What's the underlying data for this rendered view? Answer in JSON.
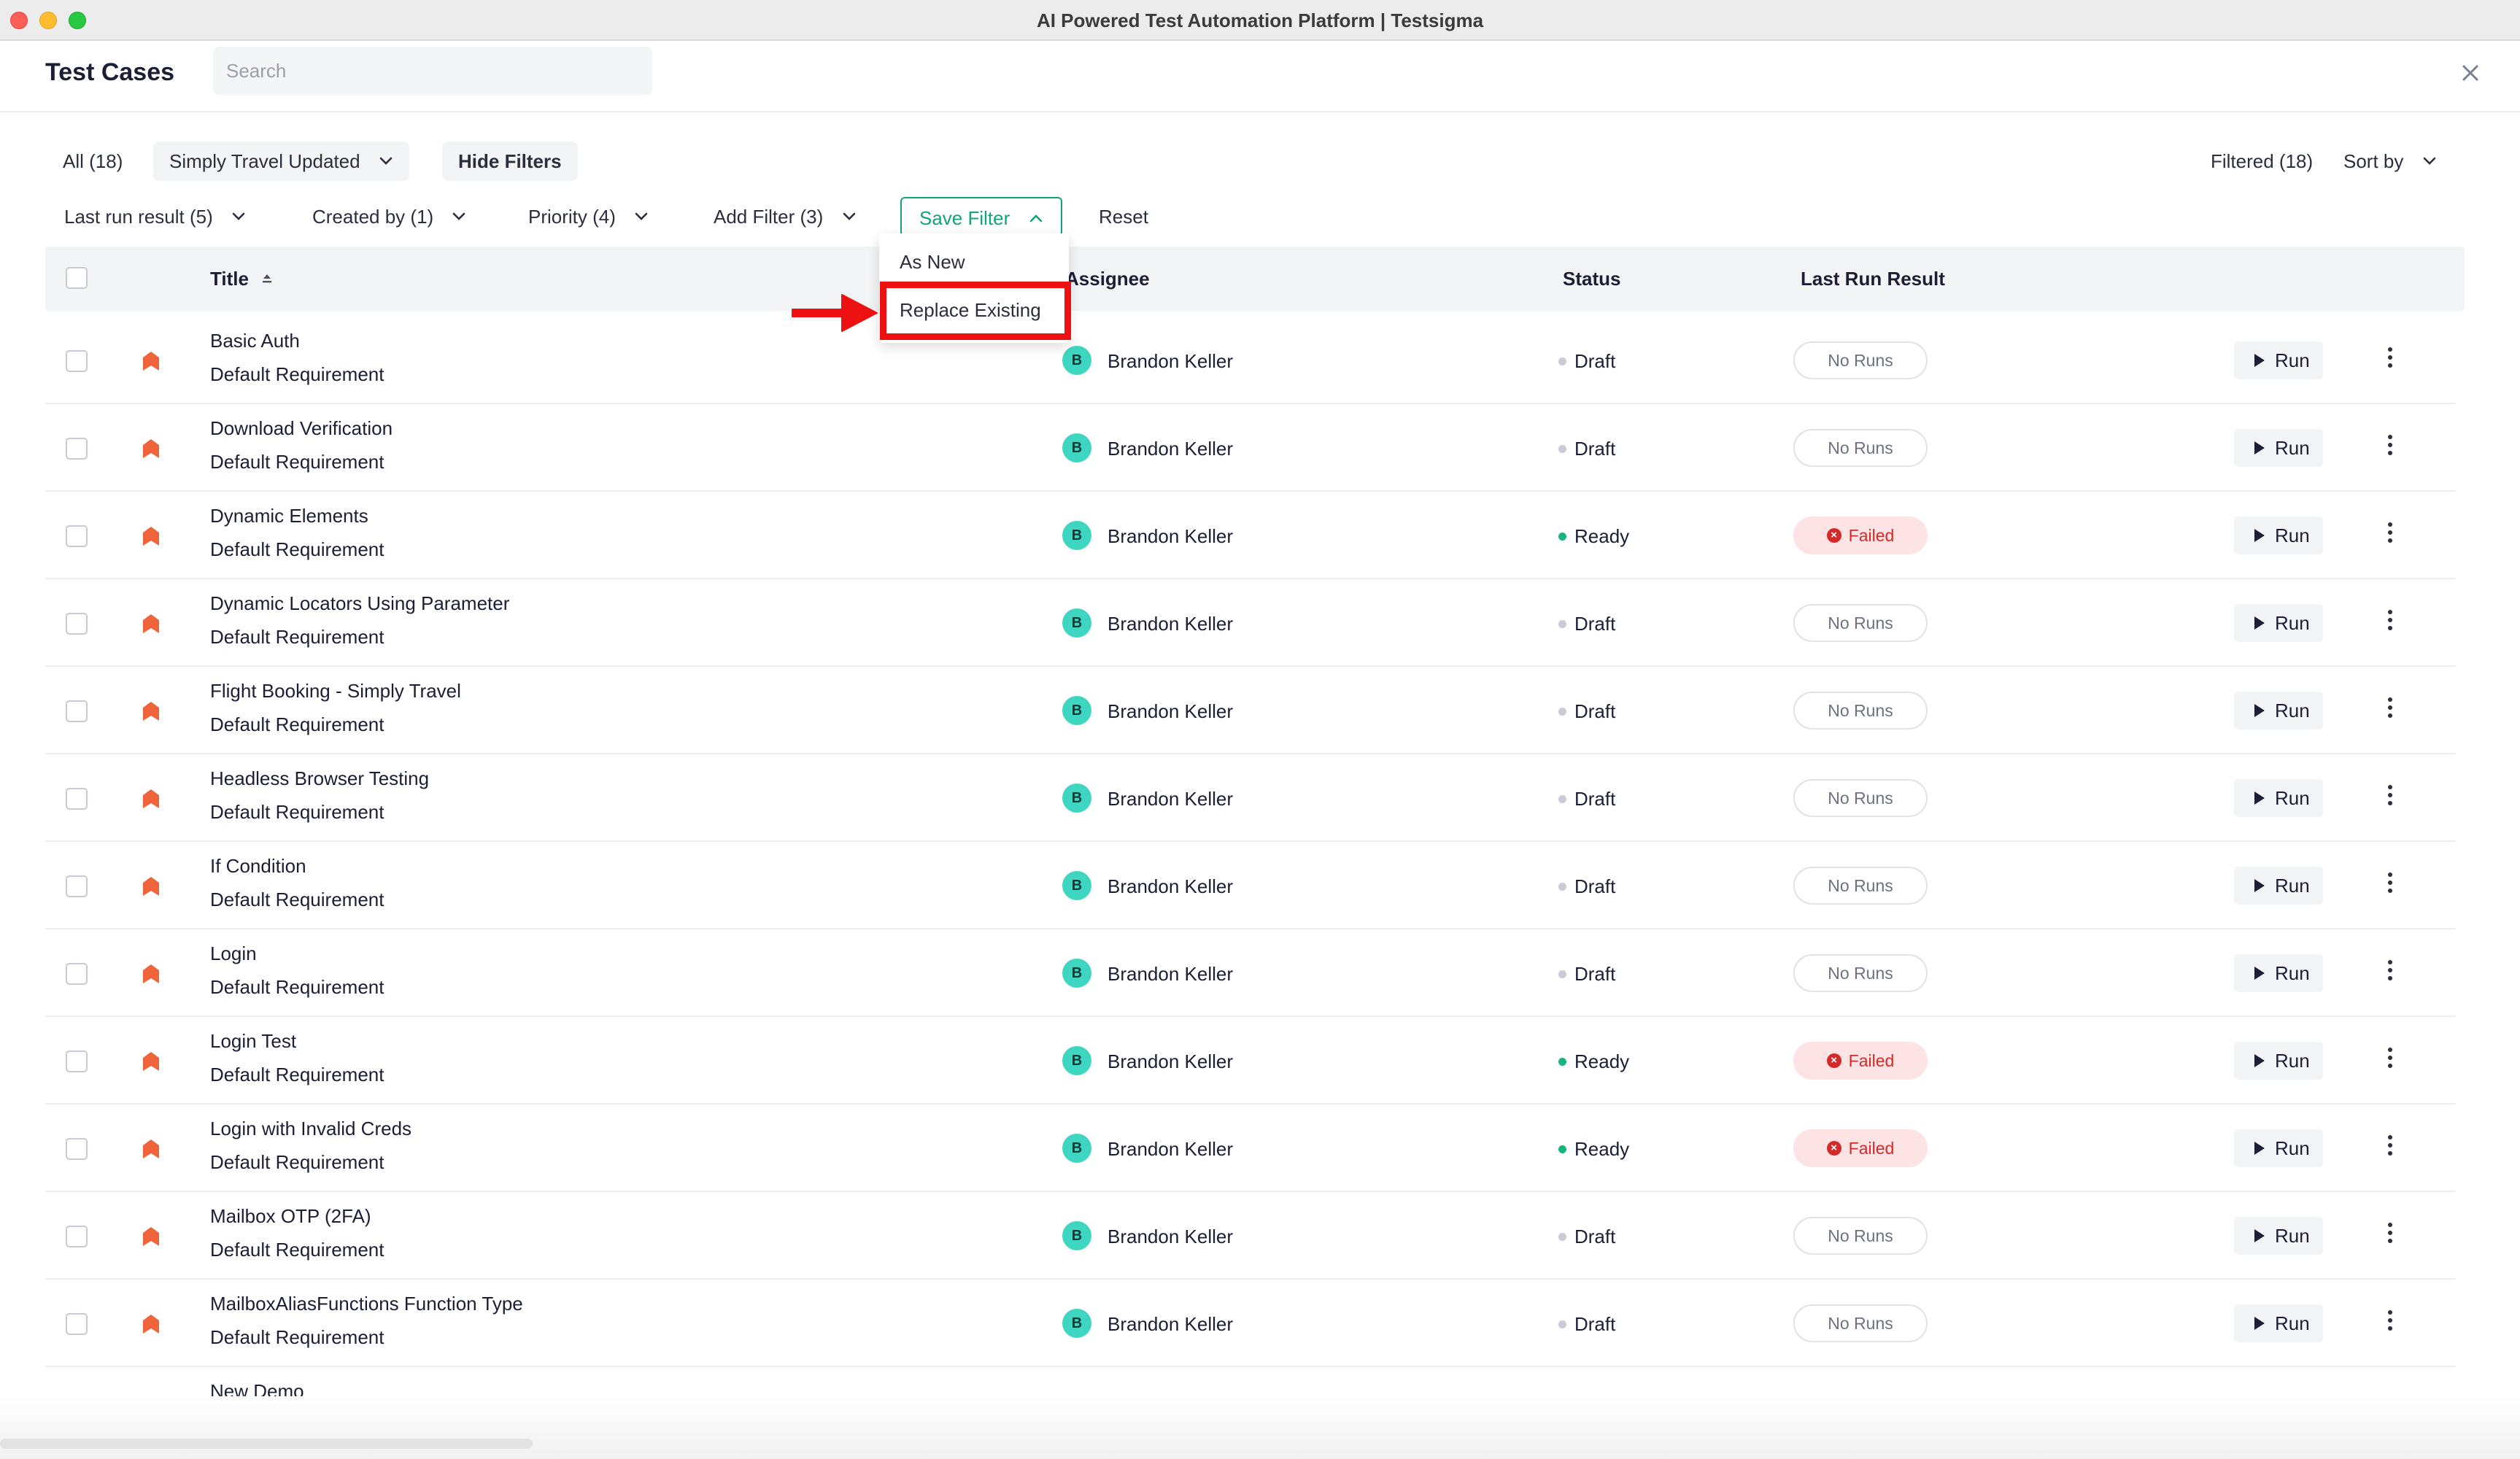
{
  "window": {
    "title": "AI Powered Test Automation Platform | Testsigma"
  },
  "header": {
    "title": "Test Cases",
    "search_placeholder": "Search"
  },
  "filters_row1": {
    "all": "All (18)",
    "saved_filter": "Simply Travel Updated",
    "hide_filters": "Hide Filters",
    "filtered": "Filtered (18)",
    "sort_by": "Sort by"
  },
  "filters_row2": {
    "last_run_result": "Last run result (5)",
    "created_by": "Created by (1)",
    "priority": "Priority (4)",
    "add_filter": "Add Filter (3)",
    "save_filter": "Save Filter",
    "reset": "Reset"
  },
  "save_filter_menu": {
    "items": [
      "As New",
      "Replace Existing"
    ],
    "highlighted": "Replace Existing"
  },
  "table": {
    "columns": {
      "title": "Title",
      "assignee": "Assignee",
      "status": "Status",
      "last_run_result": "Last Run Result"
    },
    "run_label": "Run",
    "rows": [
      {
        "title": "Basic Auth",
        "requirement": "Default Requirement",
        "avatar": "B",
        "assignee": "Brandon Keller",
        "status": "Draft",
        "result": "No Runs"
      },
      {
        "title": "Download Verification",
        "requirement": "Default Requirement",
        "avatar": "B",
        "assignee": "Brandon Keller",
        "status": "Draft",
        "result": "No Runs"
      },
      {
        "title": "Dynamic Elements",
        "requirement": "Default Requirement",
        "avatar": "B",
        "assignee": "Brandon Keller",
        "status": "Ready",
        "result": "Failed"
      },
      {
        "title": "Dynamic Locators Using Parameter",
        "requirement": "Default Requirement",
        "avatar": "B",
        "assignee": "Brandon Keller",
        "status": "Draft",
        "result": "No Runs"
      },
      {
        "title": "Flight Booking - Simply Travel",
        "requirement": "Default Requirement",
        "avatar": "B",
        "assignee": "Brandon Keller",
        "status": "Draft",
        "result": "No Runs"
      },
      {
        "title": "Headless Browser Testing",
        "requirement": "Default Requirement",
        "avatar": "B",
        "assignee": "Brandon Keller",
        "status": "Draft",
        "result": "No Runs"
      },
      {
        "title": "If Condition",
        "requirement": "Default Requirement",
        "avatar": "B",
        "assignee": "Brandon Keller",
        "status": "Draft",
        "result": "No Runs"
      },
      {
        "title": "Login",
        "requirement": "Default Requirement",
        "avatar": "B",
        "assignee": "Brandon Keller",
        "status": "Draft",
        "result": "No Runs"
      },
      {
        "title": "Login Test",
        "requirement": "Default Requirement",
        "avatar": "B",
        "assignee": "Brandon Keller",
        "status": "Ready",
        "result": "Failed"
      },
      {
        "title": "Login with Invalid Creds",
        "requirement": "Default Requirement",
        "avatar": "B",
        "assignee": "Brandon Keller",
        "status": "Ready",
        "result": "Failed"
      },
      {
        "title": "Mailbox OTP (2FA)",
        "requirement": "Default Requirement",
        "avatar": "B",
        "assignee": "Brandon Keller",
        "status": "Draft",
        "result": "No Runs"
      },
      {
        "title": "MailboxAliasFunctions Function Type",
        "requirement": "Default Requirement",
        "avatar": "B",
        "assignee": "Brandon Keller",
        "status": "Draft",
        "result": "No Runs"
      }
    ],
    "partial_row_title": "New Demo"
  },
  "colors": {
    "accent": "#12a37a",
    "priority_icon": "#f0643c",
    "avatar": "#3fd6c1",
    "status_ready_dot": "#16b67b",
    "status_draft_dot": "#c7cbd3",
    "failed_badge_bg": "#fde3e3",
    "failed_text": "#d42a2a",
    "highlight_box": "#ee1111"
  }
}
